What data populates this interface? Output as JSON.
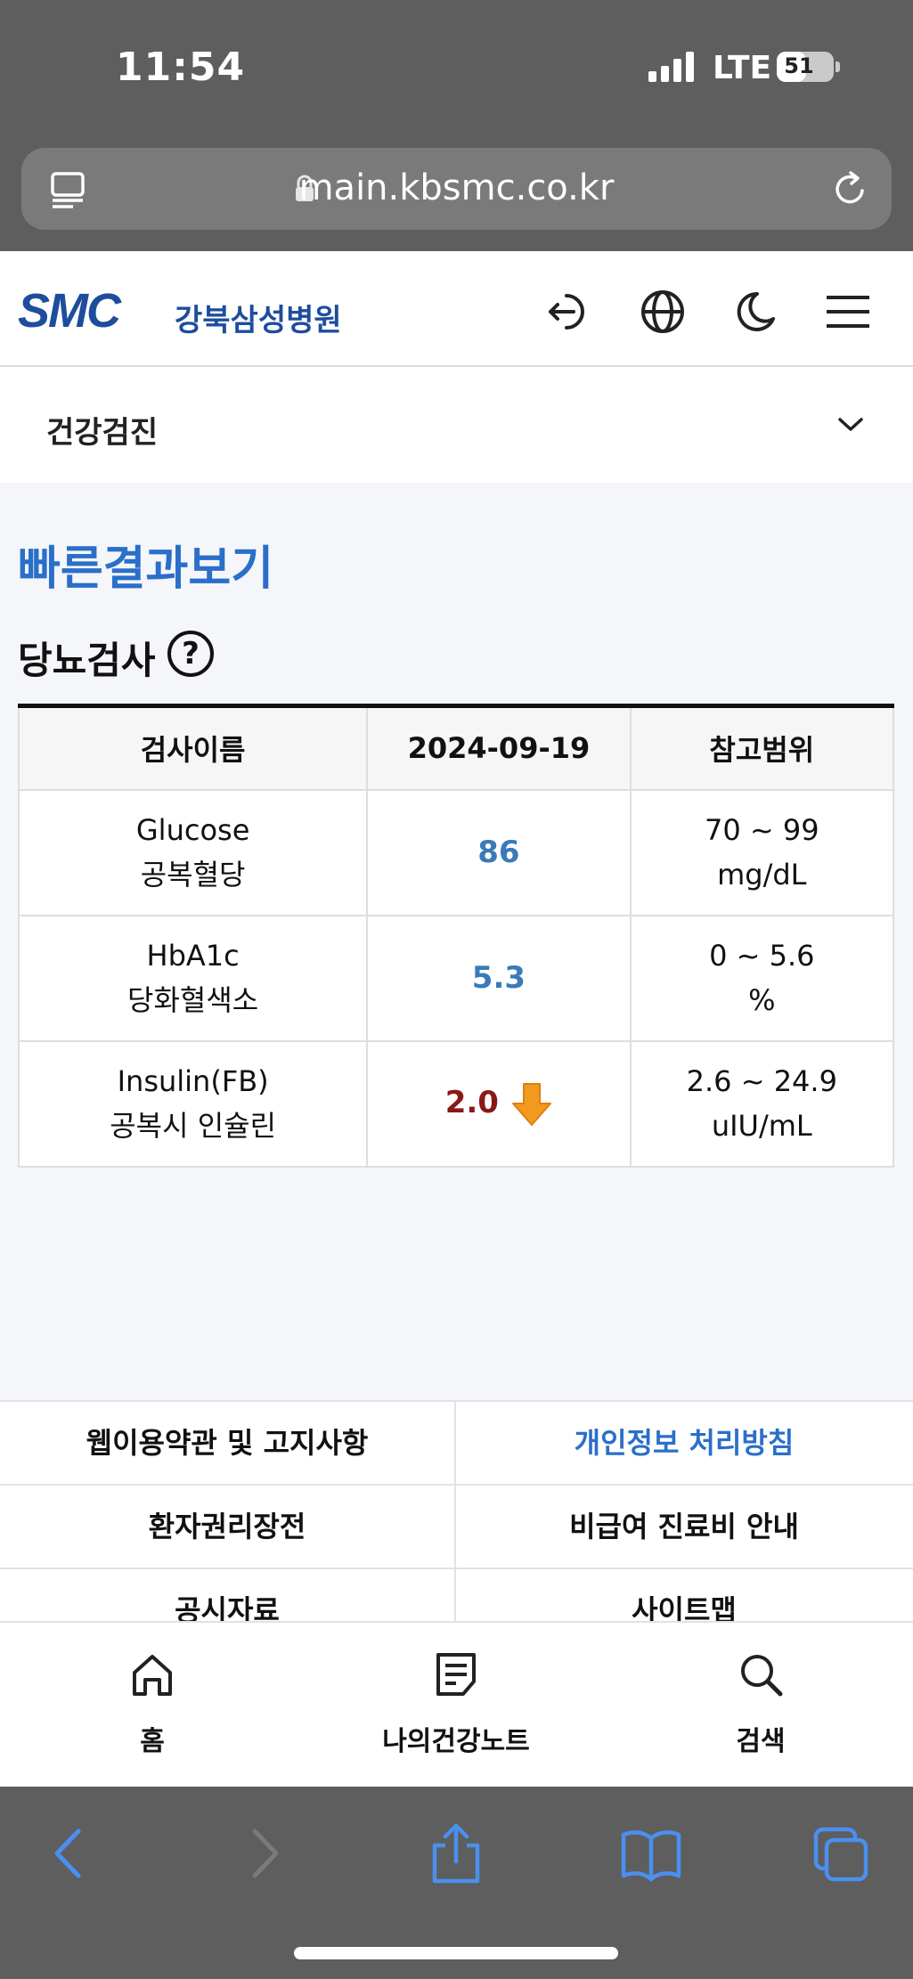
{
  "status_bar": {
    "time": "11:54",
    "network": "LTE",
    "battery": "51",
    "battery_level": 0.51
  },
  "browser": {
    "url": "main.kbsmc.co.kr"
  },
  "site": {
    "logo_text": "SMC",
    "hospital_name": "강북삼성병원",
    "brand_color": "#1e4d9c"
  },
  "header_icons": [
    "logout-icon",
    "globe-icon",
    "moon-icon",
    "menu-icon"
  ],
  "category": {
    "selected": "건강검진"
  },
  "page": {
    "title": "빠른결과보기",
    "section_title": "당뇨검사",
    "help": "?"
  },
  "table": {
    "headers": [
      "검사이름",
      "2024-09-19",
      "참고범위"
    ],
    "rows": [
      {
        "name_en": "Glucose",
        "name_kr": "공복혈당",
        "value": "86",
        "status": "normal",
        "range": "70 ~ 99",
        "unit": "mg/dL"
      },
      {
        "name_en": "HbA1c",
        "name_kr": "당화혈색소",
        "value": "5.3",
        "status": "normal",
        "range": "0 ~ 5.6",
        "unit": "%"
      },
      {
        "name_en": "Insulin(FB)",
        "name_kr": "공복시 인슐린",
        "value": "2.0",
        "status": "low",
        "range": "2.6 ~ 24.9",
        "unit": "uIU/mL"
      }
    ]
  },
  "footer_links": [
    [
      "웹이용약관 및 고지사항",
      "개인정보 처리방침"
    ],
    [
      "환자권리장전",
      "비급여 진료비 안내"
    ],
    [
      "공시자료",
      "사이트맵"
    ]
  ],
  "bottom_nav": [
    {
      "label": "홈",
      "icon": "home-icon"
    },
    {
      "label": "나의건강노트",
      "icon": "note-icon"
    },
    {
      "label": "검색",
      "icon": "search-icon"
    }
  ],
  "colors": {
    "accent": "#2a6fc9",
    "value_normal": "#3a7ab8",
    "value_low": "#8b1818",
    "arrow": "#f29a1f"
  }
}
